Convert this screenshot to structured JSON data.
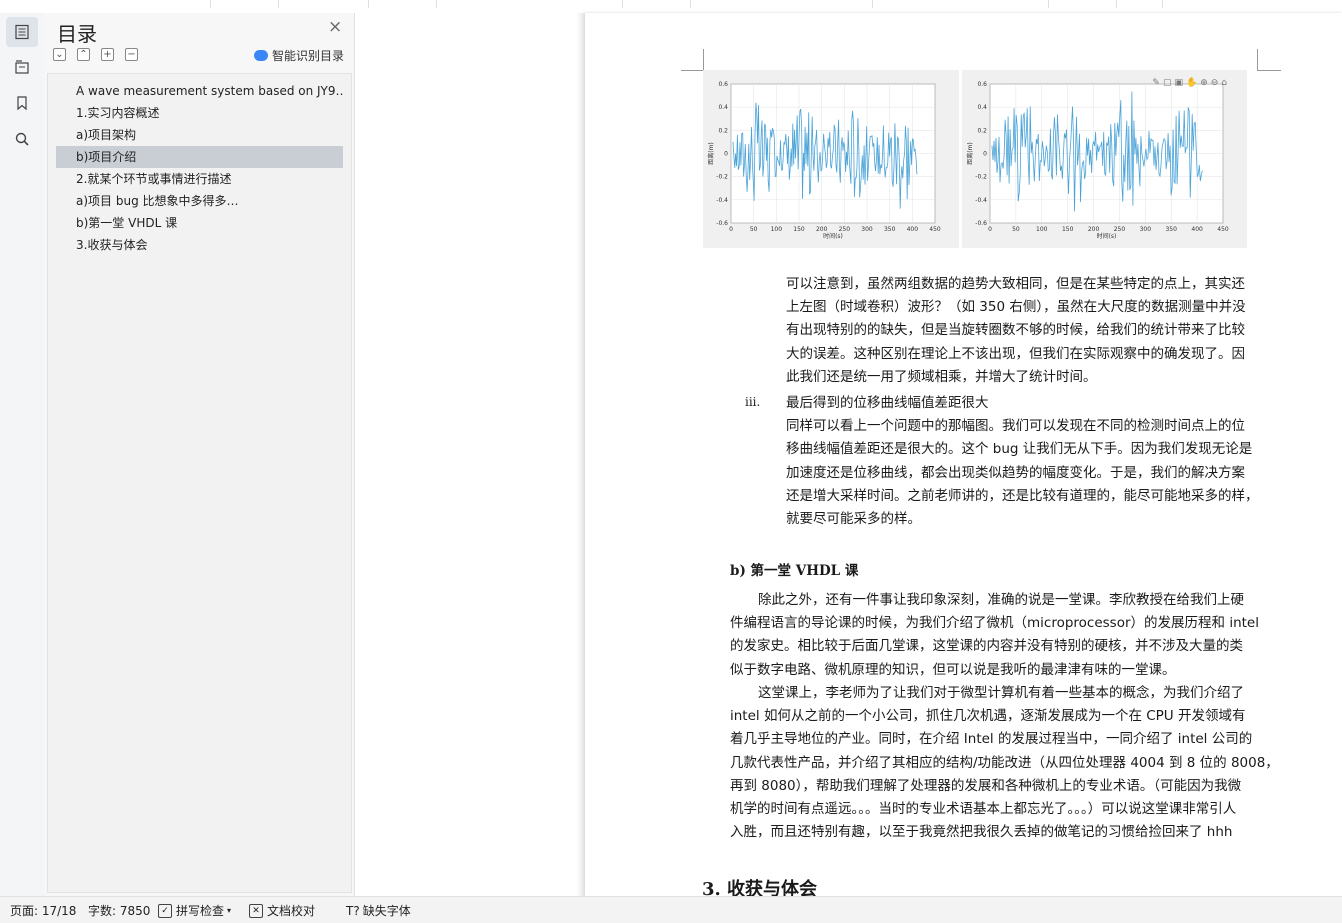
{
  "outline": {
    "title": "目录",
    "close": "×",
    "tools": [
      "⌄",
      "⌃",
      "+",
      "−"
    ],
    "smart_label": "智能识别目录",
    "items": [
      {
        "label": "A wave measurement system based on JY9…"
      },
      {
        "label": "1.实习内容概述"
      },
      {
        "label": "a)项目架构"
      },
      {
        "label": "b)项目介绍",
        "selected": true
      },
      {
        "label": "2.就某个环节或事情进行描述"
      },
      {
        "label": "a)项目 bug 比想象中多得多…"
      },
      {
        "label": "b)第一堂 VHDL 课"
      },
      {
        "label": "3.收获与体会"
      }
    ]
  },
  "figures": [
    {
      "ylabel": "距离(m)",
      "xlabel": "时间(s)",
      "yticks": [
        "0.6",
        "0.4",
        "0.2",
        "0",
        "-0.2",
        "-0.4",
        "-0.6"
      ],
      "xticks": [
        "0",
        "50",
        "100",
        "150",
        "200",
        "250",
        "300",
        "350",
        "400",
        "450"
      ]
    },
    {
      "ylabel": "距离(m)",
      "xlabel": "时间(s)",
      "yticks": [
        "0.6",
        "0.4",
        "0.2",
        "0",
        "-0.2",
        "-0.4",
        "-0.6"
      ],
      "xticks": [
        "0",
        "50",
        "100",
        "150",
        "200",
        "250",
        "300",
        "350",
        "400",
        "450"
      ]
    }
  ],
  "document": {
    "para1": [
      "可以注意到，虽然两组数据的趋势大致相同，但是在某些特定的点上，其实还",
      "上左图（时域卷积）波形？（如 350 右侧），虽然在大尺度的数据测量中并没",
      "有出现特别的的缺失，但是当旋转圈数不够的时候，给我们的统计带来了比较",
      "大的误差。这种区别在理论上不该出现，但我们在实际观察中的确发现了。因",
      "此我们还是统一用了频域相乘，并增大了统计时间。"
    ],
    "roman": "iii.",
    "para2": [
      "最后得到的位移曲线幅值差距很大",
      "同样可以看上一个问题中的那幅图。我们可以发现在不同的检测时间点上的位",
      "移曲线幅值差距还是很大的。这个 bug 让我们无从下手。因为我们发现无论是",
      "加速度还是位移曲线，都会出现类似趋势的幅度变化。于是，我们的解决方案",
      "还是增大采样时间。之前老师讲的，还是比较有道理的，能尽可能地采多的样，",
      "就要尽可能采多的样。"
    ],
    "heading_b": "b)    第一堂 VHDL 课",
    "para3": [
      "除此之外，还有一件事让我印象深刻，准确的说是一堂课。李欣教授在给我们上硬",
      "件编程语言的导论课的时候，为我们介绍了微机（microprocessor）的发展历程和 intel",
      "的发家史。相比较于后面几堂课，这堂课的内容并没有特别的硬核，并不涉及大量的类",
      "似于数字电路、微机原理的知识，但可以说是我听的最津津有味的一堂课。"
    ],
    "para4": [
      "这堂课上，李老师为了让我们对于微型计算机有着一些基本的概念，为我们介绍了",
      "intel 如何从之前的一个小公司，抓住几次机遇，逐渐发展成为一个在 CPU 开发领域有",
      "着几乎主导地位的产业。同时，在介绍 Intel 的发展过程当中，一同介绍了 intel 公司的",
      "几款代表性产品，并介绍了其相应的结构/功能改进（从四位处理器 4004 到 8 位的 8008，",
      "再到 8080），帮助我们理解了处理器的发展和各种微机上的专业术语。（可能因为我微",
      "机学的时间有点遥远。。。当时的专业术语基本上都忘光了。。。）可以说这堂课非常引人",
      "入胜，而且还特别有趣，以至于我竟然把我很久丢掉的做笔记的习惯给捡回来了 hhh"
    ],
    "heading_3": "3.  收获与体会"
  },
  "status": {
    "page": "页面: 17/18",
    "words": "字数: 7850",
    "spell": "拼写检查",
    "spell_arrow": "▾",
    "proof": "文档校对",
    "missing_font": "缺失字体"
  }
}
